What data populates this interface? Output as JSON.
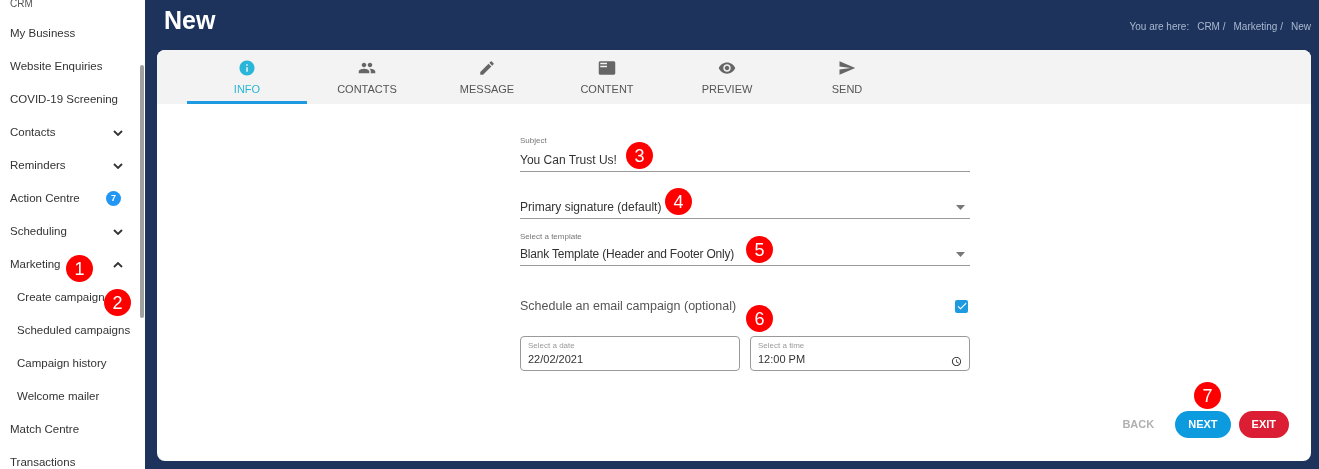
{
  "sidebar": {
    "top_item": "CRM",
    "items": [
      {
        "label": "My Business",
        "kind": "link"
      },
      {
        "label": "Website Enquiries",
        "kind": "link"
      },
      {
        "label": "COVID-19 Screening",
        "kind": "link"
      },
      {
        "label": "Contacts",
        "kind": "group",
        "expanded": false
      },
      {
        "label": "Reminders",
        "kind": "group",
        "expanded": false
      },
      {
        "label": "Action Centre",
        "kind": "badge",
        "badge": "7"
      },
      {
        "label": "Scheduling",
        "kind": "group",
        "expanded": false
      },
      {
        "label": "Marketing",
        "kind": "group",
        "expanded": true,
        "children": [
          {
            "label": "Create campaign"
          },
          {
            "label": "Scheduled campaigns"
          },
          {
            "label": "Campaign history"
          },
          {
            "label": "Welcome mailer"
          }
        ]
      },
      {
        "label": "Match Centre",
        "kind": "link"
      },
      {
        "label": "Transactions",
        "kind": "link"
      }
    ]
  },
  "page": {
    "title": "New",
    "breadcrumb": {
      "prefix": "You are here:",
      "items": [
        "CRM /",
        "Marketing /",
        "New"
      ]
    }
  },
  "tabs": [
    {
      "label": "INFO",
      "selected": true
    },
    {
      "label": "CONTACTS",
      "selected": false
    },
    {
      "label": "MESSAGE",
      "selected": false
    },
    {
      "label": "CONTENT",
      "selected": false
    },
    {
      "label": "PREVIEW",
      "selected": false
    },
    {
      "label": "SEND",
      "selected": false
    }
  ],
  "form": {
    "subject": {
      "label": "Subject",
      "value": "You Can Trust Us!"
    },
    "signature": {
      "value": "Primary signature (default)"
    },
    "template": {
      "label": "Select a template",
      "value": "Blank Template (Header and Footer Only)"
    },
    "schedule": {
      "label": "Schedule an email campaign (optional)",
      "checked": true
    },
    "date": {
      "label": "Select a date",
      "value": "22/02/2021"
    },
    "time": {
      "label": "Select a time",
      "value": "12:00 PM"
    }
  },
  "buttons": [
    {
      "label": "BACK",
      "kind": "back",
      "disabled": true
    },
    {
      "label": "NEXT",
      "kind": "next",
      "disabled": false
    },
    {
      "label": "EXIT",
      "kind": "exit",
      "disabled": false
    }
  ],
  "markers": [
    "1",
    "2",
    "3",
    "4",
    "5",
    "6",
    "7"
  ]
}
